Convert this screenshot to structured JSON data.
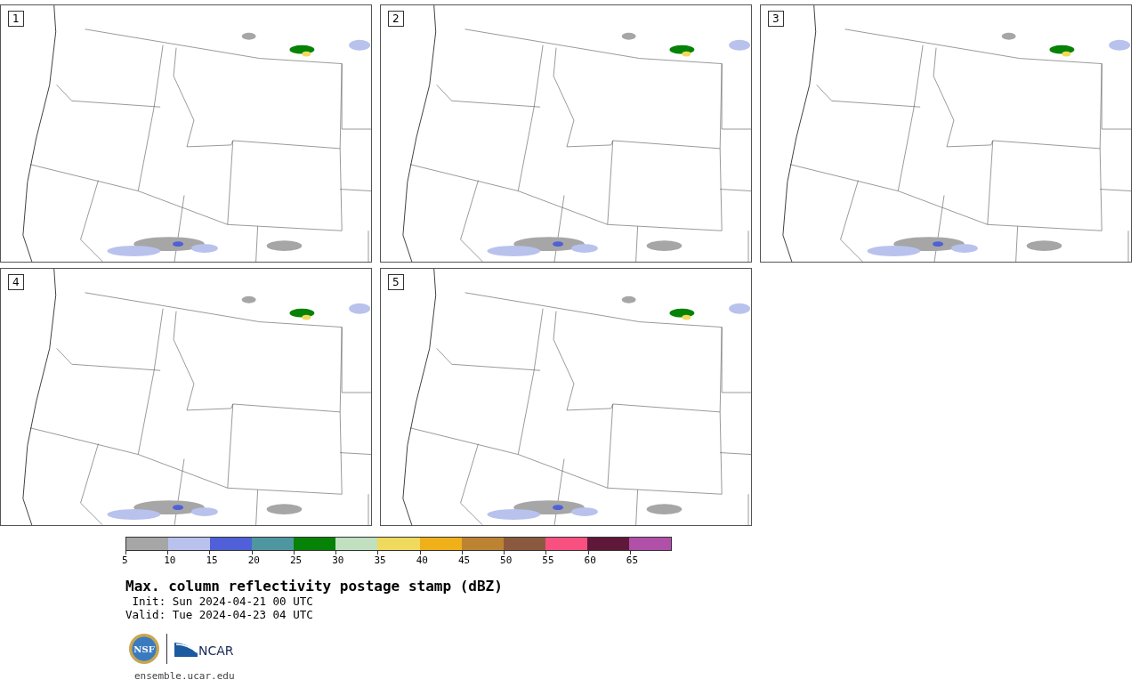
{
  "panels": [
    {
      "label": "1"
    },
    {
      "label": "2"
    },
    {
      "label": "3"
    },
    {
      "label": "4"
    },
    {
      "label": "5"
    }
  ],
  "colorbar": {
    "bins": [
      {
        "color": "#a6a6a6"
      },
      {
        "color": "#b8c2ed"
      },
      {
        "color": "#5060d8"
      },
      {
        "color": "#4f97a0"
      },
      {
        "color": "#068207"
      },
      {
        "color": "#c0e0c0"
      },
      {
        "color": "#f0da5e"
      },
      {
        "color": "#f0b01a"
      },
      {
        "color": "#bc8432"
      },
      {
        "color": "#8b5a3e"
      },
      {
        "color": "#f85080"
      },
      {
        "color": "#601838"
      },
      {
        "color": "#b050a8"
      }
    ],
    "ticks": [
      "5",
      "10",
      "15",
      "20",
      "25",
      "30",
      "35",
      "40",
      "45",
      "50",
      "55",
      "60",
      "65"
    ]
  },
  "title": "Max. column reflectivity postage stamp (dBZ)",
  "init": " Init: Sun 2024-04-21 00 UTC",
  "valid": "Valid: Tue 2024-04-23 04 UTC",
  "logos": {
    "nsf": "NSF",
    "ncar": "NCAR"
  },
  "footer": "ensemble.ucar.edu"
}
